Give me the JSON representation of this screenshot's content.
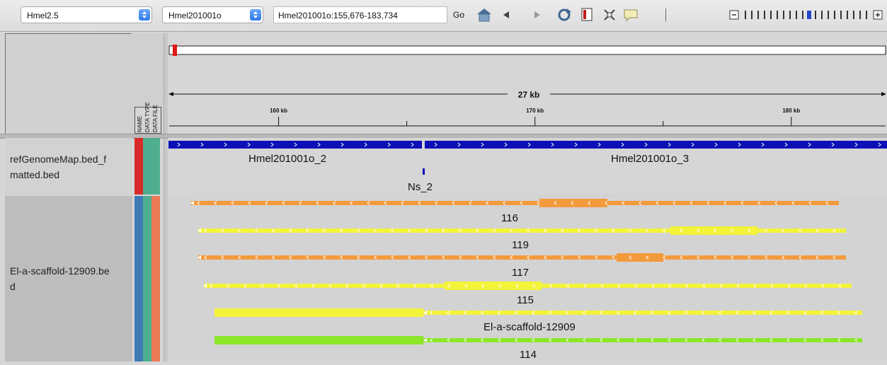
{
  "toolbar": {
    "genome": "Hmel2.5",
    "chromosome": "Hmel201001o",
    "locus": "Hmel201001o:155,676-183,734",
    "go_label": "Go"
  },
  "ruler": {
    "span_label": "27 kb",
    "ticks": [
      {
        "label": "160 kb",
        "pos": 160000
      },
      {
        "label": "170 kb",
        "pos": 170000
      },
      {
        "label": "180 kb",
        "pos": 180000
      }
    ]
  },
  "attribute_headers": [
    "NAME",
    "DATA TYPE",
    "DATA FILE"
  ],
  "tracks": {
    "ref_name": "refGenomeMap.bed_formatted.bed",
    "ref_name_lines": [
      "refGenomeMap.bed_f",
      "matted.bed"
    ],
    "ref_features": [
      "Hmel201001o_2",
      "Hmel201001o_3",
      "Ns_2"
    ],
    "scaffold_name": "El-a-scaffold-12909.bed",
    "scaffold_name_lines": [
      "El-a-scaffold-12909.be",
      "d"
    ],
    "scaffold_features": [
      "116",
      "119",
      "117",
      "115",
      "El-a-scaffold-12909",
      "114"
    ]
  },
  "colors": {
    "ref_track": "#0f0fb8",
    "orange": "#f39a3c",
    "yellow": "#f3f33a",
    "green": "#8ce62a",
    "attr_red": "#d92a2a",
    "attr_teal": "#4fae8f",
    "attr_blue": "#3d7ab4",
    "attr_salmon": "#ec7a56"
  },
  "zoom": {
    "level": 10,
    "of": 20
  }
}
